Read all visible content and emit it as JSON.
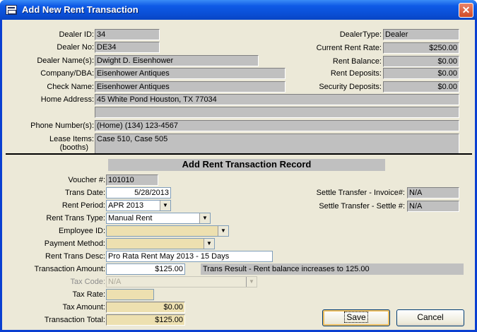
{
  "window": {
    "title": "Add New Rent Transaction"
  },
  "dealer": {
    "id_label": "Dealer ID:",
    "id": "34",
    "no_label": "Dealer No:",
    "no": "DE34",
    "name_label": "Dealer Name(s):",
    "name": "Dwight D. Eisenhower",
    "company_label": "Company/DBA:",
    "company": "Eisenhower Antiques",
    "check_label": "Check Name:",
    "check_name": "Eisenhower Antiques",
    "address_label": "Home Address:",
    "address1": "45 White Pond  Houston, TX  77034",
    "address2": "",
    "phone_label": "Phone Number(s):",
    "phone": "(Home) (134) 123-4567",
    "lease_label_1": "Lease Items:",
    "lease_label_2": "(booths)",
    "lease_items": "Case 510, Case 505",
    "type_label": "DealerType:",
    "type": "Dealer",
    "rate_label": "Current Rent Rate:",
    "rate": "$250.00",
    "balance_label": "Rent Balance:",
    "balance": "$0.00",
    "deposits_label": "Rent Deposits:",
    "deposits": "$0.00",
    "security_label": "Security Deposits:",
    "security": "$0.00"
  },
  "record": {
    "section_title": "Add Rent Transaction Record",
    "voucher_label": "Voucher #:",
    "voucher": "101010",
    "trans_date_label": "Trans Date:",
    "trans_date": "5/28/2013",
    "rent_period_label": "Rent Period:",
    "rent_period": "APR 2013",
    "rent_type_label": "Rent Trans Type:",
    "rent_type": "Manual Rent",
    "employee_label": "Employee ID:",
    "employee": "",
    "payment_label": "Payment Method:",
    "payment": "",
    "desc_label": "Rent Trans Desc:",
    "desc": "Pro Rata Rent May 2013 - 15 Days",
    "amount_label": "Transaction Amount:",
    "amount": "$125.00",
    "result": "Trans Result - Rent balance increases to 125.00",
    "tax_code_label": "Tax Code:",
    "tax_code": "N/A",
    "tax_rate_label": "Tax Rate:",
    "tax_rate": "",
    "tax_amount_label": "Tax Amount:",
    "tax_amount": "$0.00",
    "total_label": "Transaction Total:",
    "total": "$125.00",
    "settle_invoice_label": "Settle Transfer - Invoice#:",
    "settle_invoice": "N/A",
    "settle_settle_label": "Settle Transfer - Settle #:",
    "settle_settle": "N/A"
  },
  "buttons": {
    "save": "Save",
    "cancel": "Cancel"
  },
  "icons": {
    "dropdown": "chevron-down-icon",
    "close": "close-icon",
    "app": "form-icon"
  }
}
